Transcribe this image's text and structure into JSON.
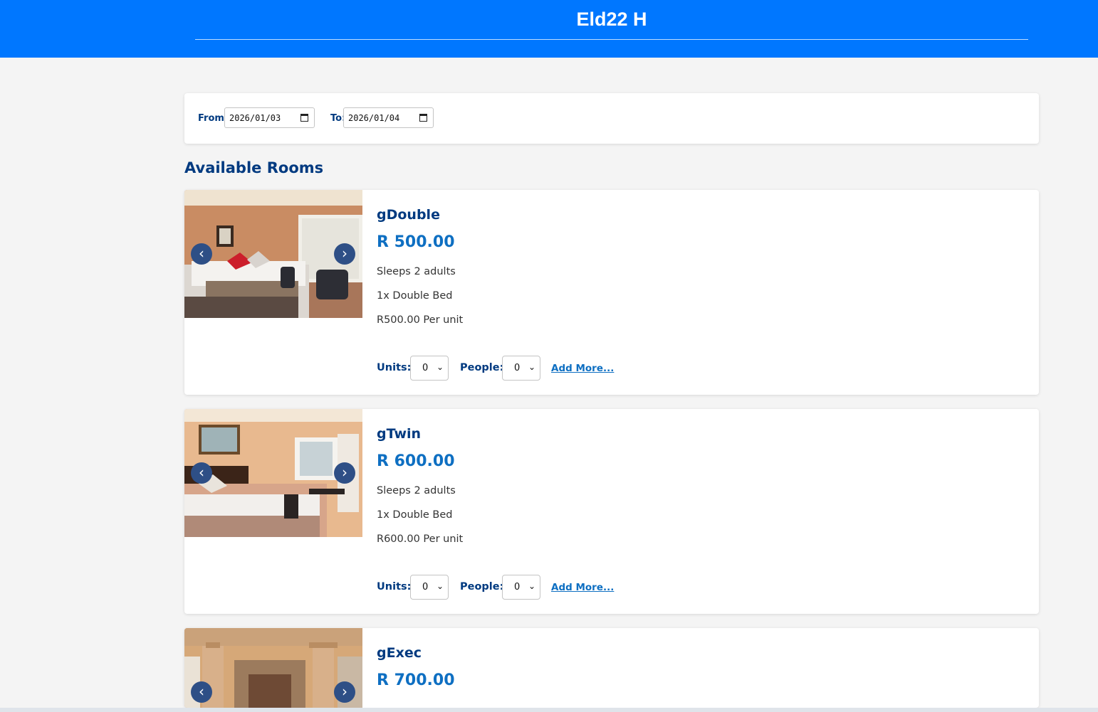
{
  "header": {
    "title": "Eld22 H"
  },
  "dates": {
    "from_label": "From:",
    "from_value": "2026/01/03",
    "to_label": "To:",
    "to_value": "2026/01/04"
  },
  "section": {
    "title": "Available Rooms"
  },
  "controls": {
    "units_label": "Units:",
    "people_label": "People:",
    "add_more": "Add More...",
    "prev_arrow": "‹",
    "next_arrow": "›",
    "select_chevron": "⌄"
  },
  "rooms": [
    {
      "name": "gDouble",
      "price": "R 500.00",
      "sleeps": "Sleeps 2 adults",
      "beds": "1x Double Bed",
      "unit_price": "R500.00 Per unit",
      "units_value": "0",
      "people_value": "0"
    },
    {
      "name": "gTwin",
      "price": "R 600.00",
      "sleeps": "Sleeps 2 adults",
      "beds": "1x Double Bed",
      "unit_price": "R600.00 Per unit",
      "units_value": "0",
      "people_value": "0"
    },
    {
      "name": "gExec",
      "price": "R 700.00"
    }
  ],
  "colors": {
    "header_bg": "#0077ff",
    "heading_text": "#003a80",
    "price_text": "#0e6fc2",
    "arrow_bg": "#2e4f86"
  }
}
